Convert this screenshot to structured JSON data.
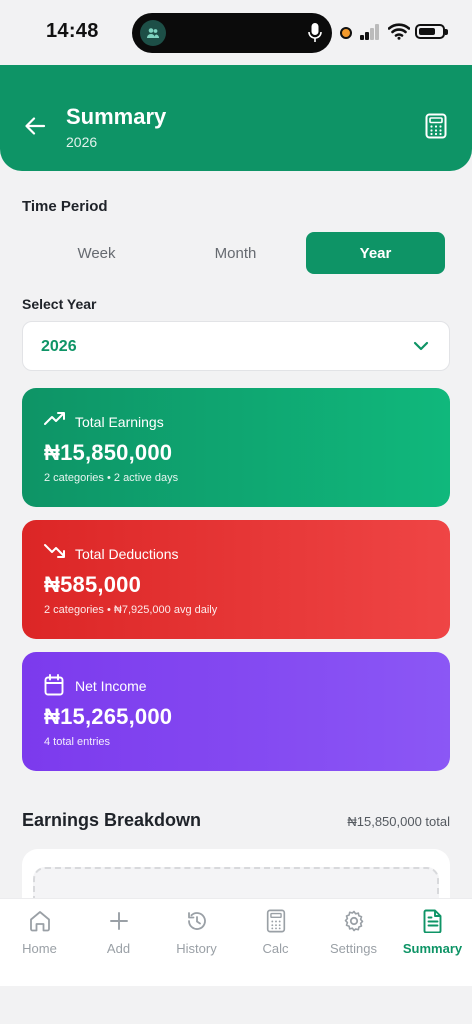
{
  "status_bar": {
    "time": "14:48"
  },
  "header": {
    "title": "Summary",
    "subtitle": "2026"
  },
  "time_period": {
    "label": "Time Period",
    "options": [
      "Week",
      "Month",
      "Year"
    ],
    "selected": "Year"
  },
  "select_year": {
    "label": "Select Year",
    "value": "2026"
  },
  "cards": {
    "earnings": {
      "title": "Total Earnings",
      "amount": "₦15,850,000",
      "meta": "2 categories • 2 active days",
      "color": "#0e9466"
    },
    "deductions": {
      "title": "Total Deductions",
      "amount": "₦585,000",
      "meta": "2 categories • ₦7,925,000 avg daily",
      "color": "#dc2626"
    },
    "net": {
      "title": "Net Income",
      "amount": "₦15,265,000",
      "meta": "4 total entries",
      "color": "#7c3aed"
    }
  },
  "breakdown": {
    "title": "Earnings Breakdown",
    "total": "₦15,850,000 total"
  },
  "tabs": [
    {
      "label": "Home",
      "icon": "home-icon"
    },
    {
      "label": "Add",
      "icon": "plus-icon"
    },
    {
      "label": "History",
      "icon": "history-icon"
    },
    {
      "label": "Calc",
      "icon": "calculator-icon"
    },
    {
      "label": "Settings",
      "icon": "gear-icon"
    },
    {
      "label": "Summary",
      "icon": "document-icon",
      "active": true
    }
  ],
  "colors": {
    "accent": "#0e9466",
    "inactive": "#9aa0a6"
  }
}
